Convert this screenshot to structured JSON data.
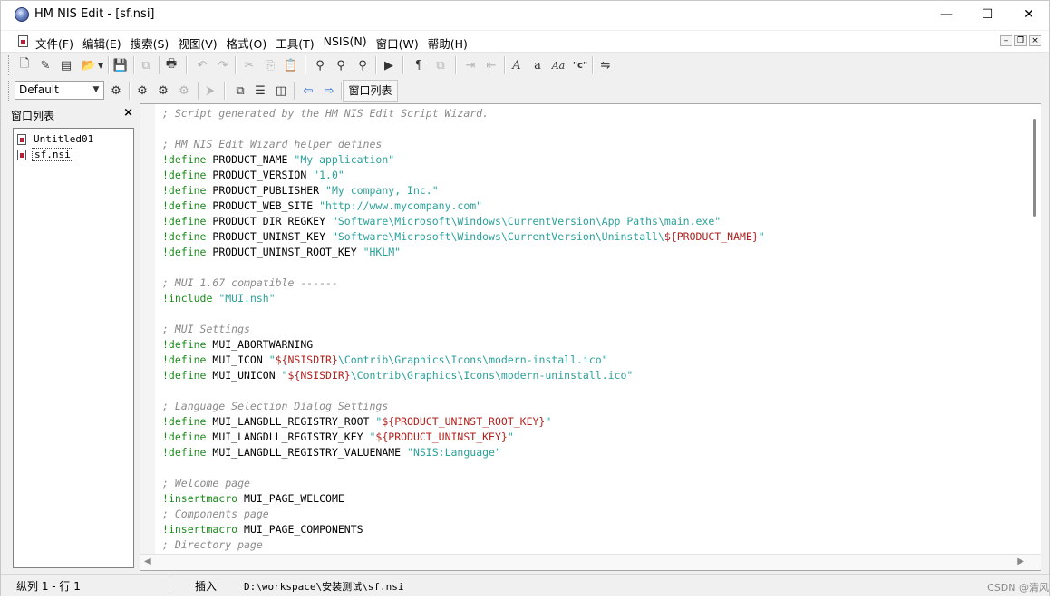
{
  "window": {
    "title": "HM NIS Edit - [sf.nsi]"
  },
  "window_controls": {
    "minimize": "—",
    "maximize": "☐",
    "close": "✕"
  },
  "menubar": {
    "items": [
      "文件(F)",
      "编辑(E)",
      "搜索(S)",
      "视图(V)",
      "格式(O)",
      "工具(T)",
      "NSIS(N)",
      "窗口(W)",
      "帮助(H)"
    ]
  },
  "toolbar2": {
    "style_select": "Default",
    "window_list_button": "窗口列表"
  },
  "sidepanel": {
    "title": "窗口列表",
    "close": "×",
    "items": [
      {
        "label": "Untitled01"
      },
      {
        "label": "sf.nsi"
      }
    ]
  },
  "editor": {
    "lines": [
      [
        [
          "cm",
          "; Script generated by the HM NIS Edit Script Wizard."
        ]
      ],
      [],
      [
        [
          "cm",
          "; HM NIS Edit Wizard helper defines"
        ]
      ],
      [
        [
          "kw",
          "!define"
        ],
        [
          "pl",
          " PRODUCT_NAME "
        ],
        [
          "str",
          "\"My application\""
        ]
      ],
      [
        [
          "kw",
          "!define"
        ],
        [
          "pl",
          " PRODUCT_VERSION "
        ],
        [
          "str",
          "\"1.0\""
        ]
      ],
      [
        [
          "kw",
          "!define"
        ],
        [
          "pl",
          " PRODUCT_PUBLISHER "
        ],
        [
          "str",
          "\"My company, Inc.\""
        ]
      ],
      [
        [
          "kw",
          "!define"
        ],
        [
          "pl",
          " PRODUCT_WEB_SITE "
        ],
        [
          "str",
          "\"http://www.mycompany.com\""
        ]
      ],
      [
        [
          "kw",
          "!define"
        ],
        [
          "pl",
          " PRODUCT_DIR_REGKEY "
        ],
        [
          "str",
          "\"Software\\Microsoft\\Windows\\CurrentVersion\\App Paths\\main.exe\""
        ]
      ],
      [
        [
          "kw",
          "!define"
        ],
        [
          "pl",
          " PRODUCT_UNINST_KEY "
        ],
        [
          "str",
          "\"Software\\Microsoft\\Windows\\CurrentVersion\\Uninstall\\"
        ],
        [
          "var",
          "${PRODUCT_NAME}"
        ],
        [
          "str",
          "\""
        ]
      ],
      [
        [
          "kw",
          "!define"
        ],
        [
          "pl",
          " PRODUCT_UNINST_ROOT_KEY "
        ],
        [
          "str",
          "\"HKLM\""
        ]
      ],
      [],
      [
        [
          "cm",
          "; MUI 1.67 compatible ------"
        ]
      ],
      [
        [
          "kw",
          "!include"
        ],
        [
          "pl",
          " "
        ],
        [
          "str",
          "\"MUI.nsh\""
        ]
      ],
      [],
      [
        [
          "cm",
          "; MUI Settings"
        ]
      ],
      [
        [
          "kw",
          "!define"
        ],
        [
          "pl",
          " MUI_ABORTWARNING"
        ]
      ],
      [
        [
          "kw",
          "!define"
        ],
        [
          "pl",
          " MUI_ICON "
        ],
        [
          "str",
          "\""
        ],
        [
          "var",
          "${NSISDIR}"
        ],
        [
          "str",
          "\\Contrib\\Graphics\\Icons\\modern-install.ico\""
        ]
      ],
      [
        [
          "kw",
          "!define"
        ],
        [
          "pl",
          " MUI_UNICON "
        ],
        [
          "str",
          "\""
        ],
        [
          "var",
          "${NSISDIR}"
        ],
        [
          "str",
          "\\Contrib\\Graphics\\Icons\\modern-uninstall.ico\""
        ]
      ],
      [],
      [
        [
          "cm",
          "; Language Selection Dialog Settings"
        ]
      ],
      [
        [
          "kw",
          "!define"
        ],
        [
          "pl",
          " MUI_LANGDLL_REGISTRY_ROOT "
        ],
        [
          "str",
          "\""
        ],
        [
          "var",
          "${PRODUCT_UNINST_ROOT_KEY}"
        ],
        [
          "str",
          "\""
        ]
      ],
      [
        [
          "kw",
          "!define"
        ],
        [
          "pl",
          " MUI_LANGDLL_REGISTRY_KEY "
        ],
        [
          "str",
          "\""
        ],
        [
          "var",
          "${PRODUCT_UNINST_KEY}"
        ],
        [
          "str",
          "\""
        ]
      ],
      [
        [
          "kw",
          "!define"
        ],
        [
          "pl",
          " MUI_LANGDLL_REGISTRY_VALUENAME "
        ],
        [
          "str",
          "\"NSIS:Language\""
        ]
      ],
      [],
      [
        [
          "cm",
          "; Welcome page"
        ]
      ],
      [
        [
          "kw",
          "!insertmacro"
        ],
        [
          "pl",
          " MUI_PAGE_WELCOME"
        ]
      ],
      [
        [
          "cm",
          "; Components page"
        ]
      ],
      [
        [
          "kw",
          "!insertmacro"
        ],
        [
          "pl",
          " MUI_PAGE_COMPONENTS"
        ]
      ],
      [
        [
          "cm",
          "; Directory page"
        ]
      ]
    ]
  },
  "statusbar": {
    "position": "纵列 1 - 行 1",
    "mode": "插入",
    "path": "D:\\workspace\\安装测试\\sf.nsi"
  },
  "watermark": "CSDN @清风"
}
